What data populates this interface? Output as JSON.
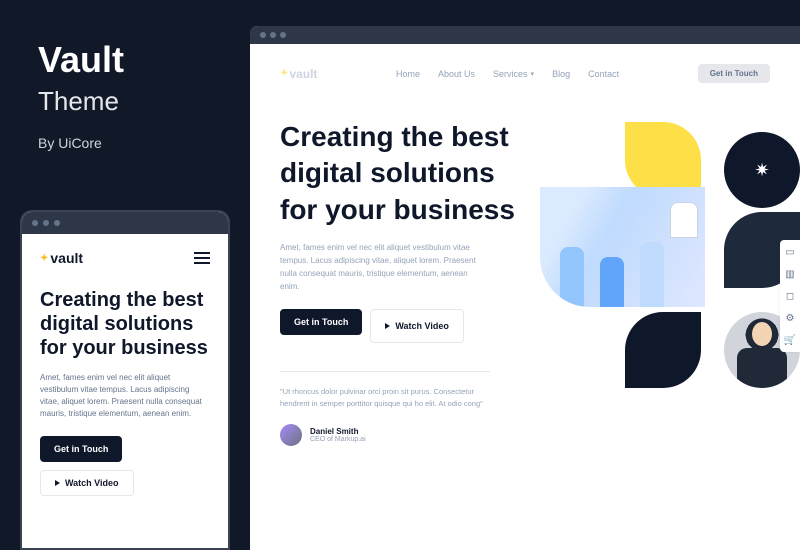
{
  "promo": {
    "title": "Vault",
    "subtitle": "Theme",
    "byline": "By UiCore"
  },
  "brand": {
    "name": "vault",
    "star": "✦"
  },
  "nav": {
    "home": "Home",
    "about": "About Us",
    "services": "Services",
    "blog": "Blog",
    "contact": "Contact",
    "cta": "Get in Touch"
  },
  "hero": {
    "heading": "Creating the best digital solutions for your business",
    "para_mobile": "Amet, fames enim vel nec elit aliquet vestibulum vitae tempus. Lacus adipiscing vitae, aliquet lorem. Praesent nulla consequat mauris, tristique elementum, aenean enim.",
    "para_desktop": "Amet, fames enim vel nec elit aliquet vestibulum vitae tempus. Lacus adipiscing vitae, aliquet lorem. Praesent nulla consequat mauris, tristique elementum, aenean enim.",
    "btn_primary": "Get in Touch",
    "btn_secondary": "Watch Video"
  },
  "testimonial": {
    "quote": "\"Ut rhoncus dolor pulvinar orci proin sit purus. Consectetur hendrerit in semper porttitor quisque qui ho elit. At odio cong\"",
    "name": "Daniel Smith",
    "role": "CEO of Markup.ai"
  },
  "graphic": {
    "spark": "✷"
  }
}
